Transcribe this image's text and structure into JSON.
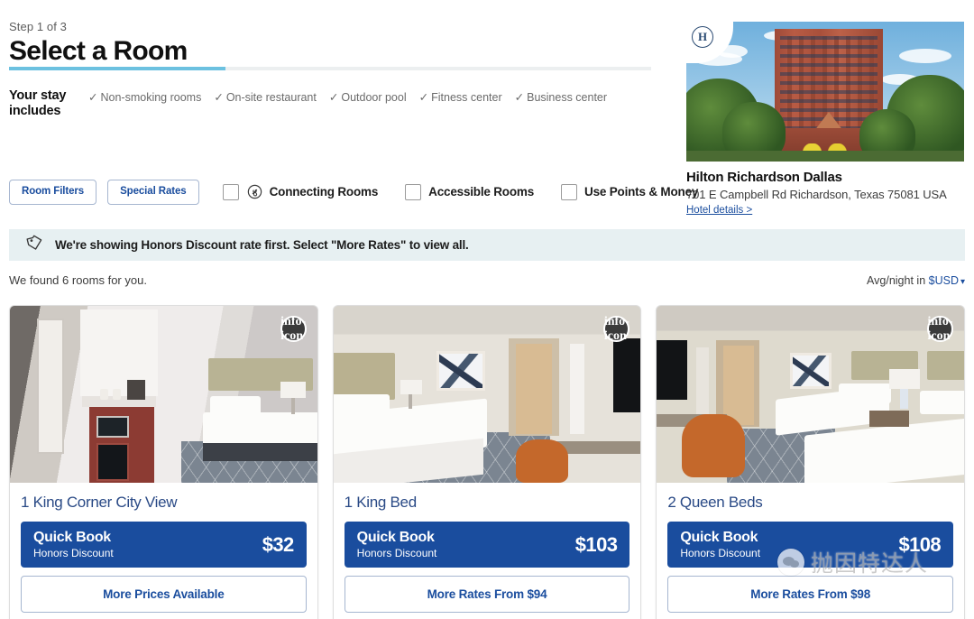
{
  "header": {
    "step_label": "Step 1 of 3",
    "title": "Select a Room",
    "progress_percent": 33
  },
  "stay": {
    "label": "Your stay includes",
    "amenities": [
      "Non-smoking rooms",
      "On-site restaurant",
      "Outdoor pool",
      "Fitness center",
      "Business center"
    ],
    "check_glyph": "✓"
  },
  "filters": {
    "room_filters_label": "Room Filters",
    "special_rates_label": "Special Rates",
    "checkboxes": [
      {
        "label": "Connecting Rooms",
        "icon": "link-circle-icon",
        "checked": false
      },
      {
        "label": "Accessible Rooms",
        "icon": "",
        "checked": false
      },
      {
        "label": "Use Points & Money",
        "icon": "",
        "checked": false
      }
    ]
  },
  "hotel": {
    "badge_icon": "hilton-h-logo-icon",
    "name": "Hilton Richardson Dallas",
    "address": "701 E Campbell Rd Richardson, Texas 75081 USA",
    "details_link": "Hotel details >"
  },
  "banner": {
    "icon": "price-tag-icon",
    "text": "We're showing Honors Discount rate first. Select \"More Rates\" to view all.",
    "background": "#e7f0f2"
  },
  "results": {
    "count_text": "We found 6 rooms for you.",
    "currency_prefix": "Avg/night in ",
    "currency_value": "$USD",
    "currency_caret": "▾"
  },
  "colors": {
    "accent_blue": "#1a4d9e",
    "progress_cyan": "#6cc1e0",
    "link_blue": "#1a4d9e",
    "room_title_blue": "#2a4a86"
  },
  "rooms": [
    {
      "name": "1 King Corner City View",
      "info_icon": "info-icon",
      "quick_book_title": "Quick Book",
      "quick_book_subtitle": "Honors Discount",
      "price": "$32",
      "more_label": "More Prices Available"
    },
    {
      "name": "1 King Bed",
      "info_icon": "info-icon",
      "quick_book_title": "Quick Book",
      "quick_book_subtitle": "Honors Discount",
      "price": "$103",
      "more_label": "More Rates From $94"
    },
    {
      "name": "2 Queen Beds",
      "info_icon": "info-icon",
      "quick_book_title": "Quick Book",
      "quick_book_subtitle": "Honors Discount",
      "price": "$108",
      "more_label": "More Rates From $98"
    }
  ],
  "watermark": {
    "icon": "wechat-icon",
    "text": "抛因特达人"
  }
}
